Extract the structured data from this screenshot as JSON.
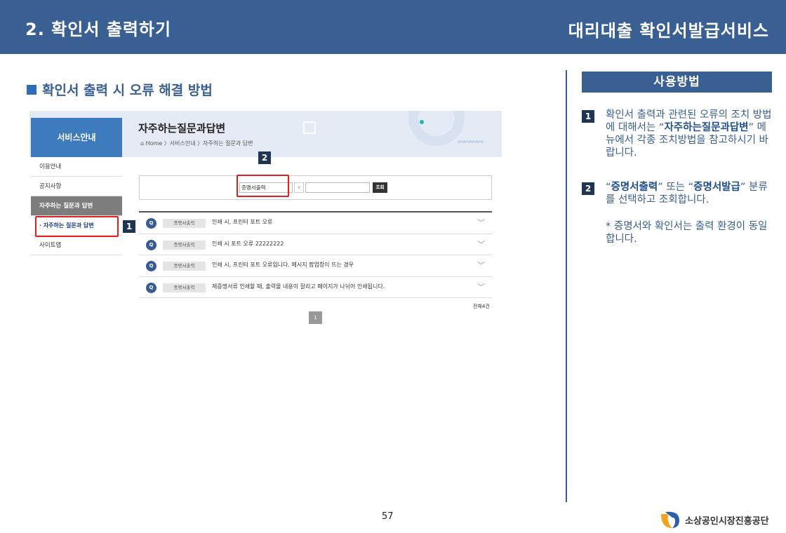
{
  "header": {
    "left_title": "2. 확인서 출력하기",
    "right_title": "대리대출 확인서발급서비스"
  },
  "section_title": "확인서 출력 시 오류 해결 방법",
  "screenshot": {
    "side_title": "서비스안내",
    "side_items": [
      "이용안내",
      "공지사항",
      "자주하는 질문과 답변",
      "· 자주하는 질문과 답변",
      "사이트맵"
    ],
    "page_title": "자주하는질문과답변",
    "breadcrumb": "⌂ Home 〉서비스안내 〉자주하는 질문과 답변",
    "search_select_value": "증명서출력",
    "search_button": "조회",
    "faq_items": [
      {
        "q": "Q",
        "category": "증명서출력",
        "text": "인쇄 시, 프린터 포트 오류"
      },
      {
        "q": "Q",
        "category": "증명서출력",
        "text": "인쇄 시 포트 오류 22222222"
      },
      {
        "q": "Q",
        "category": "증명서출력",
        "text": "인쇄 시, 프린터 포트 오류입니다. 메시지 팝업창이 뜨는 경우"
      },
      {
        "q": "Q",
        "category": "증명서출력",
        "text": "제증명서류 인쇄할 때, 출력물 내용이 잘리고 페이지가 나뉘어 인쇄됩니다."
      }
    ],
    "total": "전체4건",
    "page": "1",
    "markers": [
      "1",
      "2"
    ]
  },
  "usage": {
    "title": "사용방법",
    "step1_num": "1",
    "step1_pre": "확인서 출력과 관련된 오류의 조치 방법에 대해서는 “",
    "step1_bold": "자주하는질문과답변",
    "step1_post": "” 메뉴에서 각종 조치방법을 참고하시기 바랍니다.",
    "step2_num": "2",
    "step2_pre": "“",
    "step2_bold1": "증명서출력",
    "step2_mid": "” 또는 “",
    "step2_bold2": "증명서발급",
    "step2_post": "” 분류를 선택하고 조회합니다.",
    "note": "* 증명서와 확인서는 출력 환경이 동일합니다."
  },
  "footer": {
    "page_number": "57",
    "logo_text": "소상공인시장진흥공단"
  },
  "colors": {
    "header_bg": "#3a5f92",
    "accent_text": "#3a5f92",
    "highlight": "#e02020",
    "marker_bg": "#1f3552"
  }
}
